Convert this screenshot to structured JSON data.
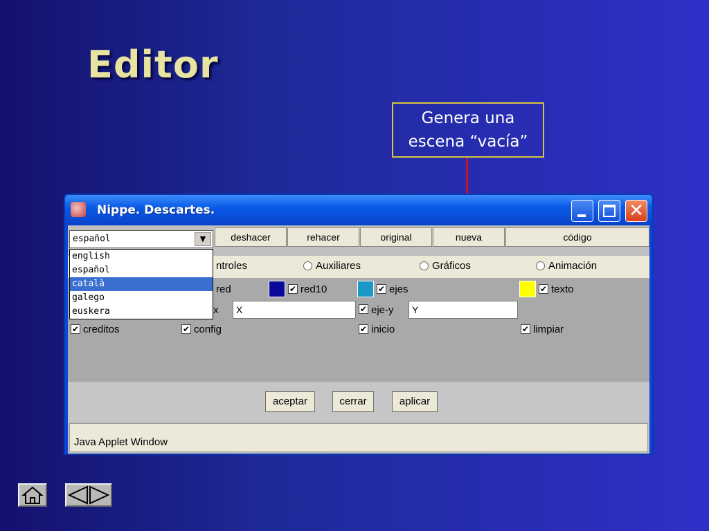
{
  "slide": {
    "title": "Editor",
    "callout_line1": "Genera una",
    "callout_line2": "escena “vacía”"
  },
  "window": {
    "title": "Nippe. Descartes.",
    "icon": "app-icon",
    "controls": {
      "minimize": "minimize-icon",
      "maximize": "maximize-icon",
      "close": "close-icon"
    }
  },
  "toolbar": {
    "language_selected": "español",
    "buttons": [
      "deshacer",
      "rehacer",
      "original",
      "nueva",
      "código"
    ]
  },
  "language_dropdown": {
    "options": [
      "english",
      "español",
      "català",
      "galego",
      "euskera"
    ],
    "highlighted": "català"
  },
  "tabs": {
    "controles_partial": "ntroles",
    "auxiliares": "Auxiliares",
    "graficos": "Gráficos",
    "animacion": "Animación"
  },
  "options": {
    "red_partial": "red",
    "red10": "red10",
    "ejes": "ejes",
    "texto": "texto",
    "x_partial": "x",
    "x_value": "X",
    "eje_y": "eje-y",
    "y_value": "Y",
    "creditos": "creditos",
    "config": "config",
    "inicio": "inicio",
    "limpiar": "limpiar"
  },
  "colors": {
    "red10_swatch": "#0a0a9a",
    "ejes_swatch": "#1a98c8",
    "texto_swatch": "#ffff00",
    "callout_border": "#d8c640",
    "arrow": "#c8102e"
  },
  "dialog_buttons": [
    "aceptar",
    "cerrar",
    "aplicar"
  ],
  "status": "Java Applet Window",
  "nav": {
    "home": "home-icon",
    "prev": "triangle-left-icon",
    "next": "triangle-right-icon"
  }
}
